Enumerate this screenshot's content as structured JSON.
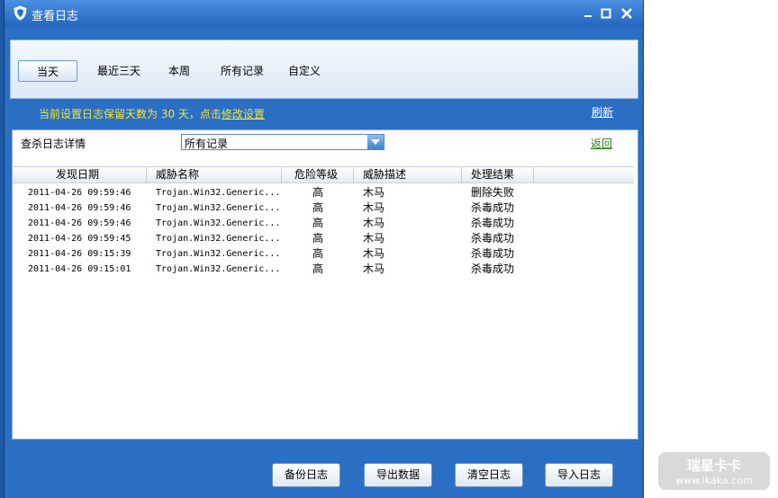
{
  "window": {
    "title": "查看日志",
    "controls": [
      "minimize-icon",
      "maximize-icon",
      "close-icon"
    ]
  },
  "tabs": [
    {
      "label": "当天",
      "active": true
    },
    {
      "label": "最近三天",
      "active": false
    },
    {
      "label": "本周",
      "active": false
    },
    {
      "label": "所有记录",
      "active": false
    },
    {
      "label": "自定义",
      "active": false
    }
  ],
  "notice": {
    "prefix": "当前设置日志保留天数为 30 天，点击",
    "link": "修改设置"
  },
  "refresh_label": "刷新",
  "detail": {
    "label": "查杀日志详情",
    "select_value": "所有记录",
    "back_label": "返回"
  },
  "table": {
    "columns": [
      "发现日期",
      "威胁名称",
      "危险等级",
      "威胁描述",
      "处理结果"
    ],
    "rows": [
      [
        "2011-04-26 09:59:46",
        "Trojan.Win32.Generic...",
        "高",
        "木马",
        "删除失败"
      ],
      [
        "2011-04-26 09:59:46",
        "Trojan.Win32.Generic...",
        "高",
        "木马",
        "杀毒成功"
      ],
      [
        "2011-04-26 09:59:46",
        "Trojan.Win32.Generic...",
        "高",
        "木马",
        "杀毒成功"
      ],
      [
        "2011-04-26 09:59:45",
        "Trojan.Win32.Generic...",
        "高",
        "木马",
        "杀毒成功"
      ],
      [
        "2011-04-26 09:15:39",
        "Trojan.Win32.Generic...",
        "高",
        "木马",
        "杀毒成功"
      ],
      [
        "2011-04-26 09:15:01",
        "Trojan.Win32.Generic...",
        "高",
        "木马",
        "杀毒成功"
      ]
    ]
  },
  "buttons": {
    "backup": "备份日志",
    "export": "导出数据",
    "clear": "清空日志",
    "import": "导入日志"
  },
  "watermark": {
    "line1": "瑞星卡卡",
    "line2": "www.ikaka.com"
  },
  "colors": {
    "window_bg": "#2a6fc4",
    "notice_text": "#f2e53a",
    "back_link": "#2e7a18"
  }
}
